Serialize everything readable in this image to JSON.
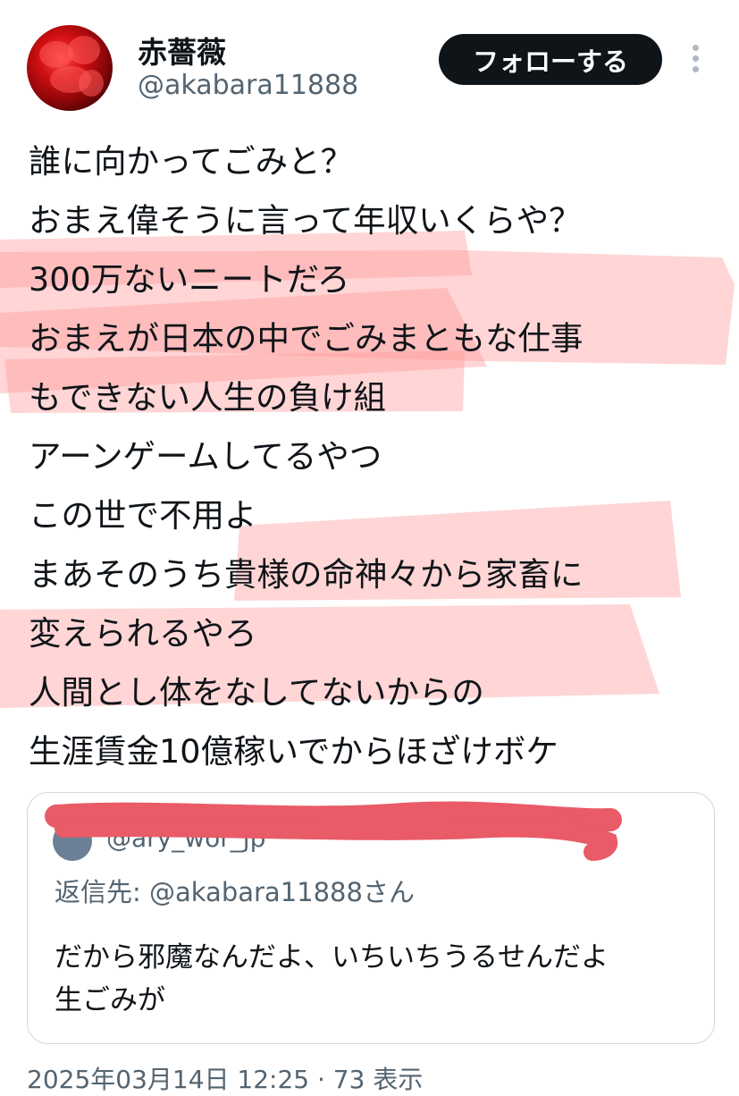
{
  "author": {
    "display_name": "赤薔薇",
    "handle": "@akabara11888",
    "avatar_icon": "red-rose-avatar"
  },
  "follow_button_label": "フォローする",
  "more_icon": "more-vertical-icon",
  "tweet_lines": [
    "誰に向かってごみと？",
    "おまえ偉そうに言って年収いくらや？",
    "300万ないニートだろ",
    "おまえが日本の中でごみまともな仕事",
    "もできない人生の負け組",
    "アーンゲームしてるやつ",
    "この世で不用よ",
    "まあそのうち貴様の命神々から家畜に",
    "変えられるやろ",
    "人間とし体をなしてないからの",
    "生涯賃金10億稼いでからほざけボケ"
  ],
  "highlight_color": "#ff9a9a",
  "redaction_color": "#e85b67",
  "quote": {
    "header_visible_fragment": "@ary_wor_jp",
    "reply_to": "返信先: @akabara11888さん",
    "text_lines": [
      "だから邪魔なんだよ、いちいちうるせんだよ",
      "生ごみが"
    ]
  },
  "footer_partial": "2025年03月14日 12:25 · 73 表示"
}
